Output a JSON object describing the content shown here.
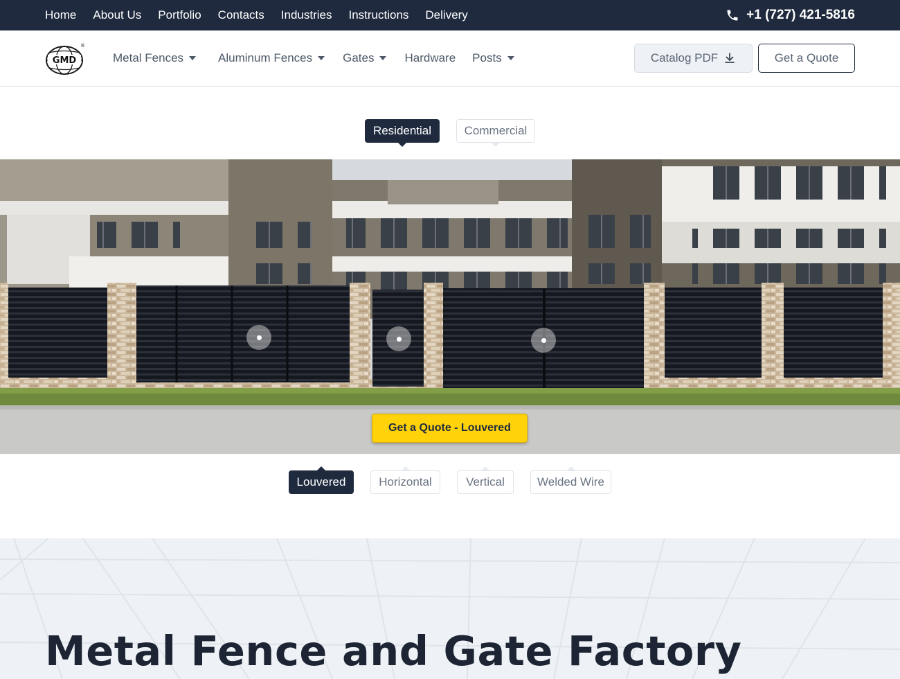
{
  "topbar": {
    "links": [
      "Home",
      "About Us",
      "Portfolio",
      "Contacts",
      "Industries",
      "Instructions",
      "Delivery"
    ],
    "phone": "+1 (727) 421-5816",
    "phone_icon": "phone-icon"
  },
  "header": {
    "logo_text": "GMD",
    "nav": {
      "metal_fences": "Metal Fences",
      "aluminum_fences": "Aluminum Fences",
      "gates": "Gates",
      "hardware": "Hardware",
      "posts": "Posts"
    },
    "catalog_label": "Catalog PDF",
    "catalog_icon": "download-icon",
    "quote_label": "Get a Quote"
  },
  "segments": {
    "residential": "Residential",
    "commercial": "Commercial"
  },
  "hero": {
    "cta_label": "Get a Quote - Louvered"
  },
  "styles": {
    "louvered": "Louvered",
    "horizontal": "Horizontal",
    "vertical": "Vertical",
    "welded_wire": "Welded Wire"
  },
  "section": {
    "headline": "Metal Fence and Gate Factory"
  },
  "colors": {
    "navy": "#1f2a3e",
    "accent_yellow": "#ffd20a",
    "section_bg": "#eef2f6"
  }
}
